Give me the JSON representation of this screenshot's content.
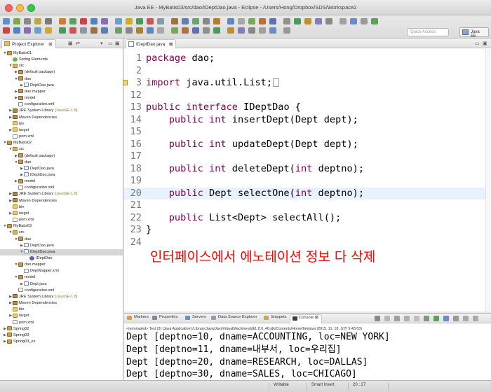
{
  "window": {
    "title": "Java EE - MyBatis03/src/dao/IDeptDao.java - Eclipse - /Users/Hong/Dropbox/SDS/Workspace2"
  },
  "toolbar": {
    "quick_access_placeholder": "Quick Access",
    "perspective_label": "Java EE"
  },
  "explorer": {
    "tab_label": "Project Explorer",
    "tree": [
      {
        "indent": 0,
        "twisty": "▼",
        "icon": "project",
        "label": "MyBatis01",
        "sub": ""
      },
      {
        "indent": 1,
        "twisty": "",
        "icon": "spring",
        "label": "Spring Elements",
        "sub": ""
      },
      {
        "indent": 1,
        "twisty": "▼",
        "icon": "src",
        "label": "src",
        "sub": ""
      },
      {
        "indent": 2,
        "twisty": "▶",
        "icon": "package",
        "label": "(default package)",
        "sub": ""
      },
      {
        "indent": 2,
        "twisty": "▼",
        "icon": "package",
        "label": "dao",
        "sub": ""
      },
      {
        "indent": 3,
        "twisty": "▶",
        "icon": "java",
        "label": "DeptDao.java",
        "sub": ""
      },
      {
        "indent": 2,
        "twisty": "▶",
        "icon": "package",
        "label": "dao.mapper",
        "sub": ""
      },
      {
        "indent": 2,
        "twisty": "▶",
        "icon": "package",
        "label": "model",
        "sub": ""
      },
      {
        "indent": 2,
        "twisty": "",
        "icon": "xml",
        "label": "configuration.xml",
        "sub": ""
      },
      {
        "indent": 1,
        "twisty": "▶",
        "icon": "library",
        "label": "JRE System Library",
        "sub": "[JavaSE-1.8]"
      },
      {
        "indent": 1,
        "twisty": "▶",
        "icon": "library",
        "label": "Maven Dependencies",
        "sub": ""
      },
      {
        "indent": 1,
        "twisty": "",
        "icon": "folder",
        "label": "bin",
        "sub": ""
      },
      {
        "indent": 1,
        "twisty": "▶",
        "icon": "folder",
        "label": "target",
        "sub": ""
      },
      {
        "indent": 1,
        "twisty": "",
        "icon": "xml",
        "label": "pom.xml",
        "sub": ""
      },
      {
        "indent": 0,
        "twisty": "▼",
        "icon": "project",
        "label": "MyBatis02",
        "sub": ""
      },
      {
        "indent": 1,
        "twisty": "▼",
        "icon": "src",
        "label": "src",
        "sub": ""
      },
      {
        "indent": 2,
        "twisty": "▶",
        "icon": "package",
        "label": "(default package)",
        "sub": ""
      },
      {
        "indent": 2,
        "twisty": "▼",
        "icon": "package",
        "label": "dao",
        "sub": ""
      },
      {
        "indent": 3,
        "twisty": "▶",
        "icon": "java",
        "label": "DeptDao.java",
        "sub": ""
      },
      {
        "indent": 3,
        "twisty": "▶",
        "icon": "interface",
        "label": "IDeptDao.java",
        "sub": ""
      },
      {
        "indent": 2,
        "twisty": "▶",
        "icon": "package",
        "label": "model",
        "sub": ""
      },
      {
        "indent": 2,
        "twisty": "",
        "icon": "xml",
        "label": "configuration.xml",
        "sub": ""
      },
      {
        "indent": 1,
        "twisty": "▶",
        "icon": "library",
        "label": "JRE System Library",
        "sub": "[JavaSE-1.8]"
      },
      {
        "indent": 1,
        "twisty": "▶",
        "icon": "library",
        "label": "Maven Dependencies",
        "sub": ""
      },
      {
        "indent": 1,
        "twisty": "",
        "icon": "folder",
        "label": "bin",
        "sub": ""
      },
      {
        "indent": 1,
        "twisty": "▶",
        "icon": "folder",
        "label": "target",
        "sub": ""
      },
      {
        "indent": 1,
        "twisty": "",
        "icon": "xml",
        "label": "pom.xml",
        "sub": ""
      },
      {
        "indent": 0,
        "twisty": "▼",
        "icon": "project",
        "label": "MyBatis03",
        "sub": ""
      },
      {
        "indent": 1,
        "twisty": "▼",
        "icon": "src",
        "label": "src",
        "sub": ""
      },
      {
        "indent": 2,
        "twisty": "▼",
        "icon": "package",
        "label": "dao",
        "sub": ""
      },
      {
        "indent": 3,
        "twisty": "▶",
        "icon": "java",
        "label": "DeptDao.java",
        "sub": ""
      },
      {
        "indent": 3,
        "twisty": "▼",
        "icon": "interface",
        "label": "IDeptDao.java",
        "sub": "",
        "selected": true
      },
      {
        "indent": 4,
        "twisty": "",
        "icon": "interface-type",
        "label": "IDeptDao",
        "sub": ""
      },
      {
        "indent": 2,
        "twisty": "▼",
        "icon": "package",
        "label": "dao.mapper",
        "sub": ""
      },
      {
        "indent": 3,
        "twisty": "",
        "icon": "xml",
        "label": "DeptMapper.xml",
        "sub": ""
      },
      {
        "indent": 2,
        "twisty": "▼",
        "icon": "package",
        "label": "model",
        "sub": ""
      },
      {
        "indent": 3,
        "twisty": "▶",
        "icon": "java",
        "label": "Dept.java",
        "sub": ""
      },
      {
        "indent": 2,
        "twisty": "",
        "icon": "xml",
        "label": "configuration.xml",
        "sub": ""
      },
      {
        "indent": 1,
        "twisty": "▶",
        "icon": "library",
        "label": "JRE System Library",
        "sub": "[JavaSE-1.8]"
      },
      {
        "indent": 1,
        "twisty": "▶",
        "icon": "library",
        "label": "Maven Dependencies",
        "sub": ""
      },
      {
        "indent": 1,
        "twisty": "",
        "icon": "folder",
        "label": "bin",
        "sub": ""
      },
      {
        "indent": 1,
        "twisty": "▶",
        "icon": "folder",
        "label": "target",
        "sub": ""
      },
      {
        "indent": 1,
        "twisty": "",
        "icon": "xml",
        "label": "pom.xml",
        "sub": ""
      },
      {
        "indent": 0,
        "twisty": "▶",
        "icon": "project",
        "label": "Spring02",
        "sub": ""
      },
      {
        "indent": 0,
        "twisty": "▶",
        "icon": "project",
        "label": "Spring03",
        "sub": ""
      },
      {
        "indent": 0,
        "twisty": "▶",
        "icon": "project",
        "label": "Spring03_ex",
        "sub": ""
      }
    ]
  },
  "editor": {
    "tab_label": "IDeptDao.java",
    "lines": [
      {
        "num": "1",
        "text": "package dao;",
        "highlight": false
      },
      {
        "num": "2",
        "text": "",
        "highlight": false
      },
      {
        "num": "3",
        "text": "import java.util.List;",
        "highlight": false,
        "marker": true,
        "fold": true
      },
      {
        "num": "12",
        "text": "",
        "highlight": false
      },
      {
        "num": "13",
        "text": "public interface IDeptDao {",
        "highlight": false
      },
      {
        "num": "14",
        "text": "    public int insertDept(Dept dept);",
        "highlight": false
      },
      {
        "num": "15",
        "text": "",
        "highlight": false
      },
      {
        "num": "16",
        "text": "    public int updateDept(Dept dept);",
        "highlight": false
      },
      {
        "num": "17",
        "text": "",
        "highlight": false
      },
      {
        "num": "18",
        "text": "    public int deleteDept(int deptno);",
        "highlight": false
      },
      {
        "num": "19",
        "text": "",
        "highlight": false
      },
      {
        "num": "20",
        "text": "    public Dept selectOne(int deptno);",
        "highlight": true
      },
      {
        "num": "21",
        "text": "",
        "highlight": false
      },
      {
        "num": "22",
        "text": "    public List<Dept> selectAll();",
        "highlight": false
      },
      {
        "num": "23",
        "text": "}",
        "highlight": false
      },
      {
        "num": "24",
        "text": "",
        "highlight": false
      }
    ],
    "annotation": "인터페이스에서 에노테이션 정보 다 삭제",
    "annotation_color": "#ff0000",
    "keyword_color": "#7f0055",
    "current_line_color": "#e8f2fe"
  },
  "console": {
    "tabs": [
      {
        "label": "Markers",
        "icon": "markers-icon"
      },
      {
        "label": "Properties",
        "icon": "properties-icon"
      },
      {
        "label": "Servers",
        "icon": "servers-icon"
      },
      {
        "label": "Data Source Explorer",
        "icon": "data-source-icon"
      },
      {
        "label": "Snippets",
        "icon": "snippets-icon"
      },
      {
        "label": "Console",
        "icon": "console-icon",
        "active": true
      }
    ],
    "terminated": "<terminated> Test (3) [Java Application] /Library/Java/JavaVirtualMachines/jdk1.8.0_40.jdk/Contents/Home/bin/java (2015. 11. 18. 오전 9:43:03)",
    "output": [
      "Dept [deptno=10, dname=ACCOUNTING, loc=NEW YORK]",
      "Dept [deptno=11, dname=내부서, loc=우리집]",
      "Dept [deptno=20, dname=RESEARCH, loc=DALLAS]",
      "Dept [deptno=30, dname=SALES, loc=CHICAGO]"
    ]
  },
  "status": {
    "writable": "Writable",
    "insert_mode": "Smart Insert",
    "position": "20 : 27"
  }
}
